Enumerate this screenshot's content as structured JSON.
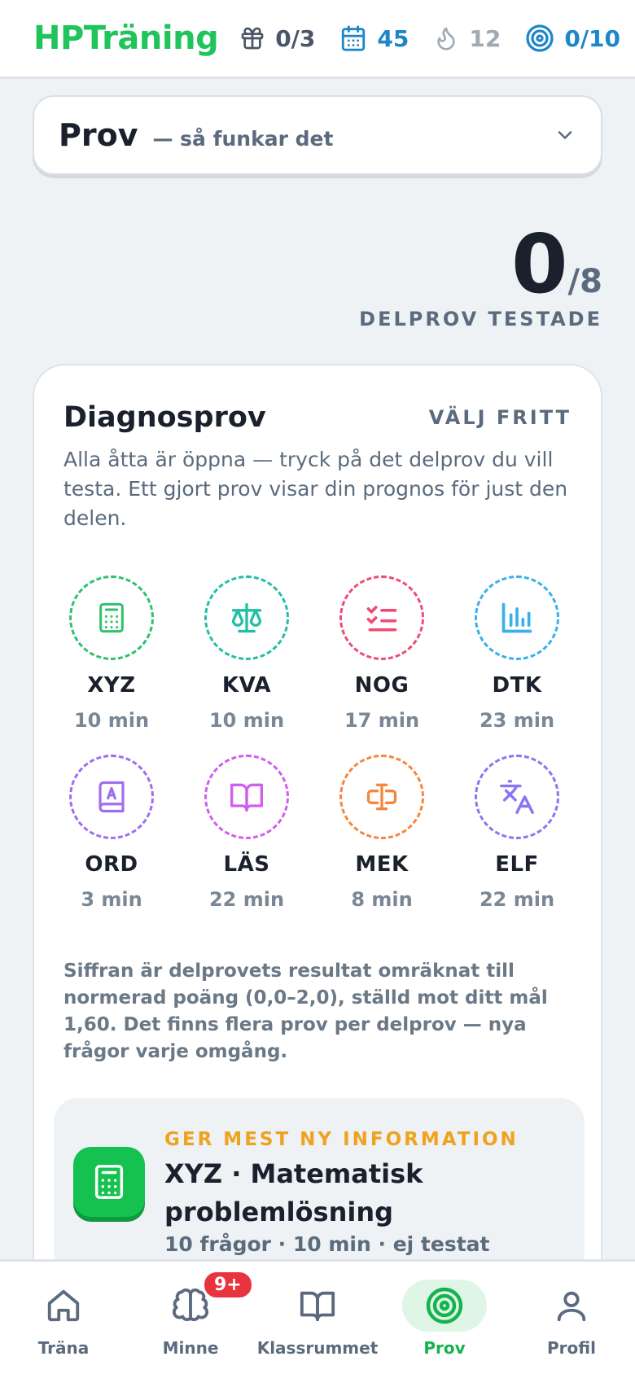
{
  "header": {
    "logo": "HPTräning",
    "stats": {
      "gifts": "0/3",
      "calendar": "45",
      "streak": "12",
      "goal": "0/10"
    },
    "icons": [
      "gift-icon",
      "calendar-icon",
      "flame-icon",
      "target-icon"
    ]
  },
  "mode": {
    "title": "Prov",
    "subtitle": "— så funkar det"
  },
  "counter": {
    "value": "0",
    "total": "/8",
    "label": "DELPROV TESTADE"
  },
  "diagnos": {
    "title": "Diagnosprov",
    "free_label": "VÄLJ FRITT",
    "description": "Alla åtta är öppna — tryck på det delprov du vill testa. Ett gjort prov visar din prognos för just den delen.",
    "tests": [
      {
        "code": "XYZ",
        "time": "10 min",
        "color": "#2fc26b",
        "icon": "calculator-icon"
      },
      {
        "code": "KVA",
        "time": "10 min",
        "color": "#22bfa5",
        "icon": "scale-icon"
      },
      {
        "code": "NOG",
        "time": "17 min",
        "color": "#ef4b73",
        "icon": "checklist-icon"
      },
      {
        "code": "DTK",
        "time": "23 min",
        "color": "#3ab0ea",
        "icon": "bar-chart-icon"
      },
      {
        "code": "ORD",
        "time": "3 min",
        "color": "#a06df2",
        "icon": "dictionary-icon"
      },
      {
        "code": "LÄS",
        "time": "22 min",
        "color": "#d05ef0",
        "icon": "open-book-icon"
      },
      {
        "code": "MEK",
        "time": "8 min",
        "color": "#f4873b",
        "icon": "text-cursor-icon"
      },
      {
        "code": "ELF",
        "time": "22 min",
        "color": "#8a76f0",
        "icon": "translate-icon"
      }
    ],
    "note": "Siffran är delprovets resultat omräknat till normerad poäng (0,0–2,0), ställd mot ditt mål 1,60. Det finns flera prov per delprov — nya frågor varje omgång."
  },
  "recommendation": {
    "kicker": "GER MEST NY INFORMATION",
    "title": "XYZ · Matematisk problemlösning",
    "meta": "10 frågor · 10 min · ej testat"
  },
  "nav": {
    "items": [
      {
        "label": "Träna",
        "icon": "home-icon"
      },
      {
        "label": "Minne",
        "icon": "brain-icon",
        "badge": "9+"
      },
      {
        "label": "Klassrummet",
        "icon": "book-icon"
      },
      {
        "label": "Prov",
        "icon": "target-icon",
        "active": true
      },
      {
        "label": "Profil",
        "icon": "user-icon"
      }
    ]
  }
}
